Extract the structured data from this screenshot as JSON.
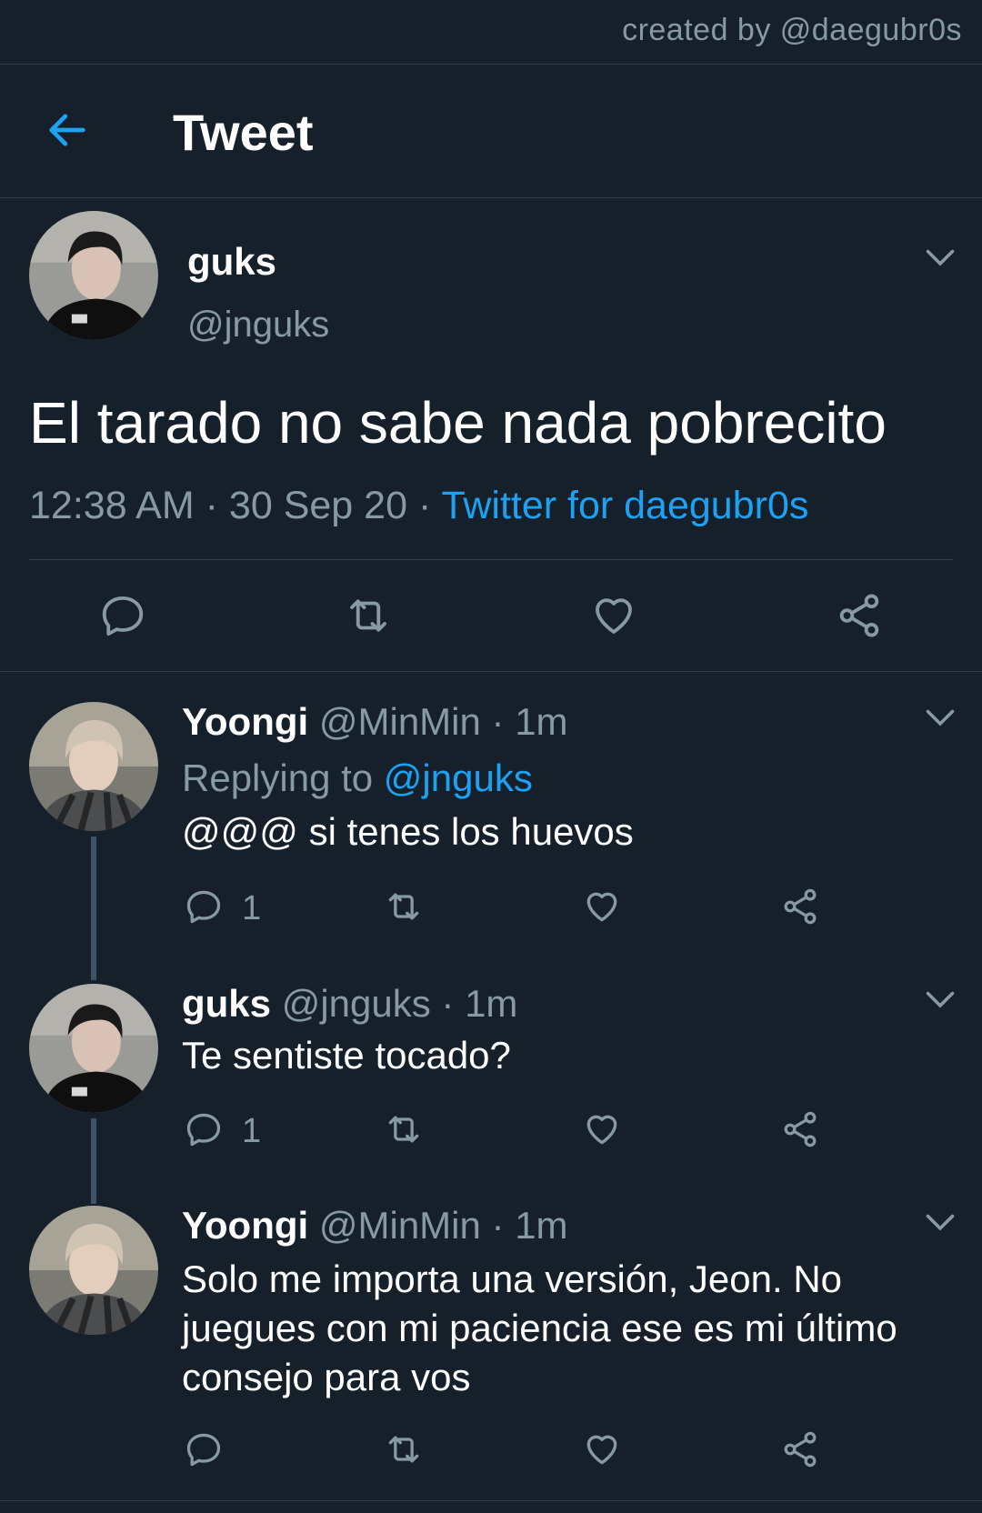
{
  "credit": "created by @daegubr0s",
  "header": {
    "title": "Tweet"
  },
  "main_tweet": {
    "name": "guks",
    "handle": "@jnguks",
    "text": "El tarado no sabe nada pobrecito",
    "time": "12:38 AM",
    "date": "30 Sep 20",
    "source": "Twitter for daegubr0s"
  },
  "replies": [
    {
      "name": "Yoongi",
      "handle": "@MinMin",
      "age": "1m",
      "replying_label": "Replying to",
      "replying_handle": "@jnguks",
      "text": "@@@ si tenes los huevos",
      "reply_count": "1"
    },
    {
      "name": "guks",
      "handle": "@jnguks",
      "age": "1m",
      "text": "Te sentiste tocado?",
      "reply_count": "1"
    },
    {
      "name": "Yoongi",
      "handle": "@MinMin",
      "age": "1m",
      "text": "Solo me importa una versión, Jeon. No juegues con mi paciencia ese es mi último consejo para vos",
      "reply_count": ""
    }
  ],
  "colors": {
    "background": "#15202b",
    "accent": "#1da1f2",
    "muted": "#8899a6"
  }
}
